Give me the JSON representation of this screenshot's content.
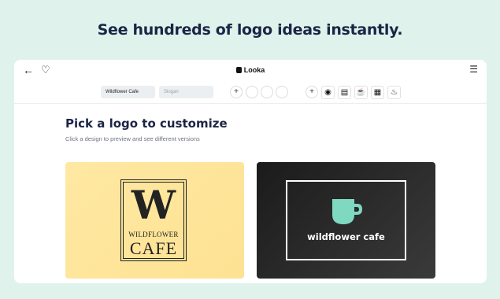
{
  "headline": "See hundreds of logo ideas instantly.",
  "topbar": {
    "brand": "Looka",
    "back_icon": "back-arrow-icon",
    "favorite_icon": "heart-icon",
    "menu_icon": "hamburger-menu-icon"
  },
  "toolbar": {
    "company_name": "Wildflower Cafe",
    "slogan_placeholder": "Slogan",
    "add_label": "+",
    "symbols": [
      "globe-icon",
      "storefront-icon",
      "coffee-cup-icon",
      "coffee-machine-icon",
      "tea-pot-icon"
    ]
  },
  "main": {
    "title": "Pick a logo to customize",
    "subtitle": "Click a design to preview and see different versions"
  },
  "logos": [
    {
      "letter": "W",
      "line1": "WILDFLOWER",
      "line2": "CAFE",
      "bg": "#fde292"
    },
    {
      "text": "wildflower cafe",
      "bg": "#1b1b1b",
      "icon_color": "#7fd8c0"
    }
  ],
  "colors": {
    "background": "#dff3ec",
    "headline": "#1c2546"
  }
}
